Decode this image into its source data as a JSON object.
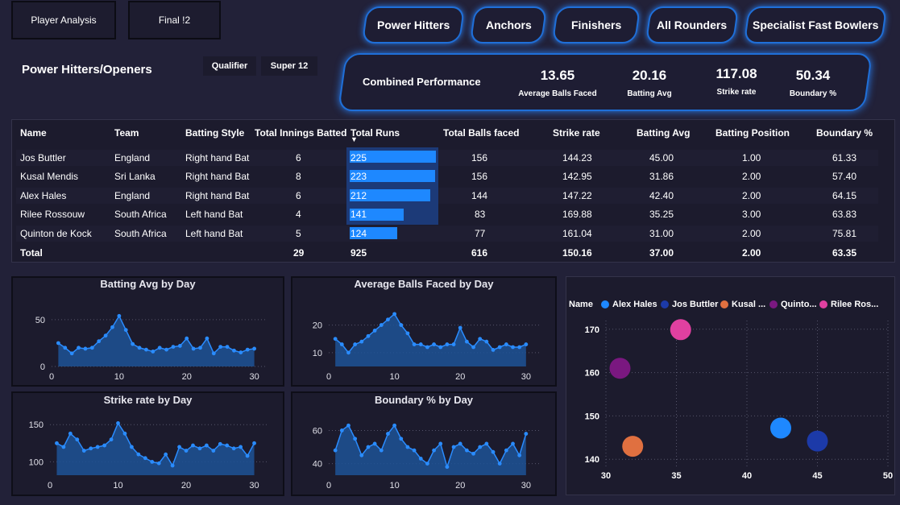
{
  "nav": {
    "player_analysis": "Player Analysis",
    "final": "Final !2"
  },
  "categories": [
    "Power Hitters",
    "Anchors",
    "Finishers",
    "All Rounders",
    "Specialist Fast Bowlers"
  ],
  "page_title": "Power Hitters/Openers",
  "stages": [
    "Qualifier",
    "Super 12"
  ],
  "kpis": {
    "label": "Combined Performance",
    "items": [
      {
        "value": "13.65",
        "label": "Average Balls Faced"
      },
      {
        "value": "20.16",
        "label": "Batting Avg"
      },
      {
        "value": "117.08",
        "label": "Strike rate"
      },
      {
        "value": "50.34",
        "label": "Boundary %"
      }
    ]
  },
  "table": {
    "headers": [
      "Name",
      "Team",
      "Batting Style",
      "Total Innings Batted",
      "Total Runs",
      "Total Balls faced",
      "Strike rate",
      "Batting Avg",
      "Batting Position",
      "Boundary %"
    ],
    "sort_indicator": "▼",
    "rows": [
      {
        "name": "Jos Buttler",
        "team": "England",
        "style": "Right hand Bat",
        "innings": "6",
        "runs": "225",
        "balls": "156",
        "sr": "144.23",
        "avg": "45.00",
        "pos": "1.00",
        "boundary": "61.33"
      },
      {
        "name": "Kusal Mendis",
        "team": "Sri Lanka",
        "style": "Right hand Bat",
        "innings": "8",
        "runs": "223",
        "balls": "156",
        "sr": "142.95",
        "avg": "31.86",
        "pos": "2.00",
        "boundary": "57.40"
      },
      {
        "name": "Alex Hales",
        "team": "England",
        "style": "Right hand Bat",
        "innings": "6",
        "runs": "212",
        "balls": "144",
        "sr": "147.22",
        "avg": "42.40",
        "pos": "2.00",
        "boundary": "64.15"
      },
      {
        "name": "Rilee Rossouw",
        "team": "South Africa",
        "style": "Left hand Bat",
        "innings": "4",
        "runs": "141",
        "balls": "83",
        "sr": "169.88",
        "avg": "35.25",
        "pos": "3.00",
        "boundary": "63.83"
      },
      {
        "name": "Quinton de Kock",
        "team": "South Africa",
        "style": "Left hand Bat",
        "innings": "5",
        "runs": "124",
        "balls": "77",
        "sr": "161.04",
        "avg": "31.00",
        "pos": "2.00",
        "boundary": "75.81"
      }
    ],
    "total": {
      "name": "Total",
      "innings": "29",
      "runs": "925",
      "balls": "616",
      "sr": "150.16",
      "avg": "37.00",
      "pos": "2.00",
      "boundary": "63.35"
    }
  },
  "colors": {
    "accent": "#1e88ff",
    "background": "#222138",
    "panel": "#1c1b2d",
    "glow": "#2a7ef0"
  },
  "chart_data": [
    {
      "type": "area",
      "title": "Batting Avg by Day",
      "x": [
        1,
        2,
        3,
        4,
        5,
        6,
        7,
        8,
        9,
        10,
        11,
        12,
        13,
        14,
        15,
        16,
        17,
        18,
        19,
        20,
        21,
        22,
        23,
        24,
        25,
        26,
        27,
        28,
        29,
        30
      ],
      "values": [
        25,
        20,
        14,
        20,
        19,
        20,
        27,
        33,
        42,
        54,
        39,
        24,
        20,
        18,
        16,
        20,
        18,
        21,
        22,
        30,
        19,
        20,
        30,
        14,
        21,
        21,
        17,
        15,
        18,
        19
      ],
      "xlim": [
        0,
        31
      ],
      "ylim": [
        0,
        62
      ],
      "xticks": [
        "0",
        "10",
        "20",
        "30"
      ],
      "yticks": [
        "0",
        "50"
      ]
    },
    {
      "type": "area",
      "title": "Average Balls Faced by Day",
      "x": [
        1,
        2,
        3,
        4,
        5,
        6,
        7,
        8,
        9,
        10,
        11,
        12,
        13,
        14,
        15,
        16,
        17,
        18,
        19,
        20,
        21,
        22,
        23,
        24,
        25,
        26,
        27,
        28,
        29,
        30
      ],
      "values": [
        15,
        13,
        10,
        13,
        14,
        16,
        18,
        20,
        22,
        24,
        20,
        17,
        13,
        13,
        12,
        13,
        12,
        13,
        13,
        19,
        14,
        12,
        15,
        14,
        11,
        12,
        13,
        12,
        12,
        13
      ],
      "xlim": [
        0,
        31
      ],
      "ylim": [
        5,
        26
      ],
      "xticks": [
        "0",
        "10",
        "20",
        "30"
      ],
      "yticks": [
        "10",
        "20"
      ]
    },
    {
      "type": "area",
      "title": "Strike rate by Day",
      "x": [
        1,
        2,
        3,
        4,
        5,
        6,
        7,
        8,
        9,
        10,
        11,
        12,
        13,
        14,
        15,
        16,
        17,
        18,
        19,
        20,
        21,
        22,
        23,
        24,
        25,
        26,
        27,
        28,
        29,
        30
      ],
      "values": [
        125,
        120,
        138,
        130,
        115,
        118,
        120,
        122,
        130,
        152,
        138,
        120,
        110,
        105,
        100,
        98,
        110,
        95,
        120,
        115,
        122,
        118,
        122,
        115,
        124,
        122,
        118,
        120,
        108,
        125
      ],
      "xlim": [
        0,
        31
      ],
      "ylim": [
        82,
        160
      ],
      "xticks": [
        "0",
        "10",
        "20",
        "30"
      ],
      "yticks": [
        "100",
        "150"
      ]
    },
    {
      "type": "area",
      "title": "Boundary % by Day",
      "x": [
        1,
        2,
        3,
        4,
        5,
        6,
        7,
        8,
        9,
        10,
        11,
        12,
        13,
        14,
        15,
        16,
        17,
        18,
        19,
        20,
        21,
        22,
        23,
        24,
        25,
        26,
        27,
        28,
        29,
        30
      ],
      "values": [
        48,
        60,
        63,
        55,
        45,
        50,
        52,
        48,
        58,
        63,
        55,
        50,
        48,
        43,
        40,
        48,
        52,
        38,
        50,
        52,
        48,
        46,
        50,
        52,
        47,
        40,
        48,
        52,
        45,
        58
      ],
      "xlim": [
        0,
        31
      ],
      "ylim": [
        33,
        68
      ],
      "xticks": [
        "0",
        "10",
        "20",
        "30"
      ],
      "yticks": [
        "40",
        "60"
      ]
    },
    {
      "type": "scatter",
      "legend_title": "Name",
      "series": [
        {
          "name": "Alex Hales",
          "x": 42.4,
          "y": 147.2,
          "color": "#1e88ff"
        },
        {
          "name": "Jos Buttler",
          "x": 45.0,
          "y": 144.2,
          "color": "#1c3aa8"
        },
        {
          "name": "Kusal ...",
          "x": 31.9,
          "y": 143.0,
          "color": "#e07040"
        },
        {
          "name": "Quinto...",
          "x": 31.0,
          "y": 161.0,
          "color": "#7a1880"
        },
        {
          "name": "Rilee Ros...",
          "x": 35.3,
          "y": 169.9,
          "color": "#e040a0"
        }
      ],
      "xlim": [
        30,
        50
      ],
      "ylim": [
        138,
        172
      ],
      "xticks": [
        "30",
        "35",
        "40",
        "45",
        "50"
      ],
      "yticks": [
        "140",
        "150",
        "160",
        "170"
      ]
    }
  ]
}
